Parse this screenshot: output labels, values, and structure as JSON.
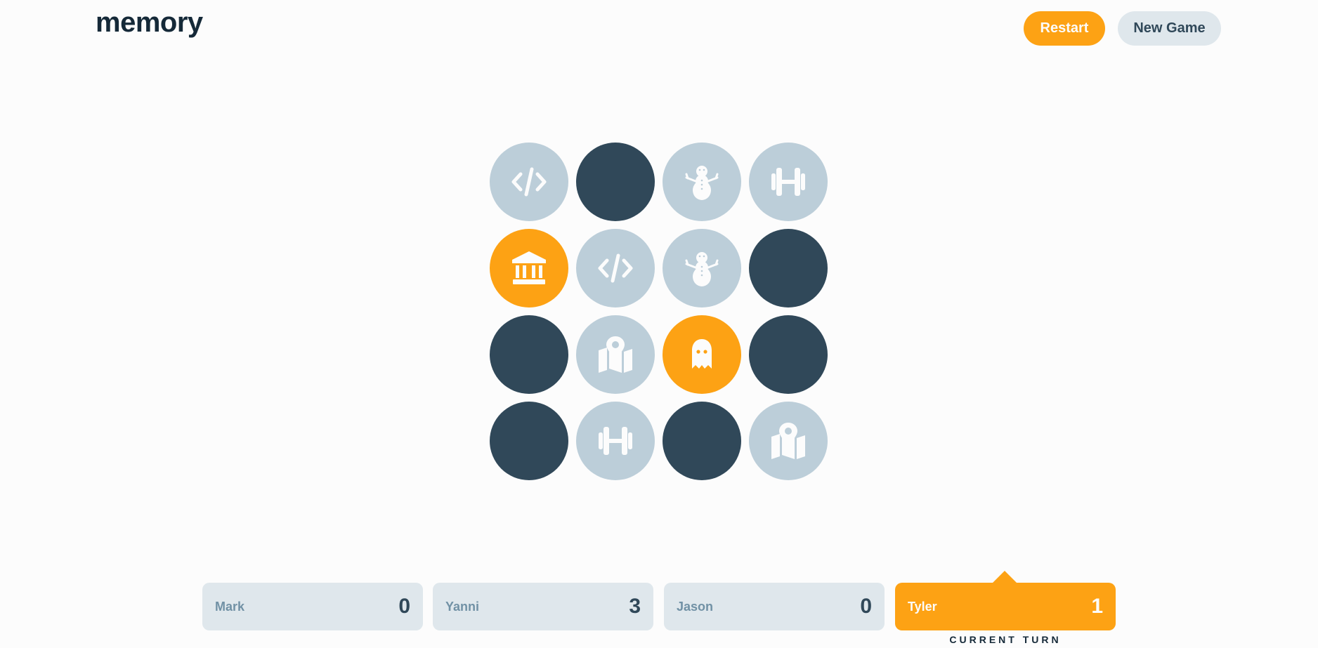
{
  "header": {
    "logo": "memory",
    "restart_label": "Restart",
    "new_game_label": "New Game"
  },
  "colors": {
    "hidden": "#304859",
    "matched": "#BCCED9",
    "active": "#FDA214",
    "text_dark": "#152938",
    "panel": "#DFE7EC"
  },
  "board": {
    "rows": 4,
    "cols": 4,
    "tiles": [
      {
        "state": "matched",
        "icon": "code-icon"
      },
      {
        "state": "hidden",
        "icon": ""
      },
      {
        "state": "matched",
        "icon": "snowman-icon"
      },
      {
        "state": "matched",
        "icon": "dumbbell-icon"
      },
      {
        "state": "active",
        "icon": "landmark-icon"
      },
      {
        "state": "matched",
        "icon": "code-icon"
      },
      {
        "state": "matched",
        "icon": "snowman-icon"
      },
      {
        "state": "hidden",
        "icon": ""
      },
      {
        "state": "hidden",
        "icon": ""
      },
      {
        "state": "matched",
        "icon": "map-location-icon"
      },
      {
        "state": "active",
        "icon": "ghost-icon"
      },
      {
        "state": "hidden",
        "icon": ""
      },
      {
        "state": "hidden",
        "icon": ""
      },
      {
        "state": "matched",
        "icon": "dumbbell-icon"
      },
      {
        "state": "hidden",
        "icon": ""
      },
      {
        "state": "matched",
        "icon": "map-location-icon"
      }
    ]
  },
  "players": [
    {
      "name": "Mark",
      "score": "0"
    },
    {
      "name": "Yanni",
      "score": "3"
    },
    {
      "name": "Jason",
      "score": "0"
    },
    {
      "name": "Tyler",
      "score": "1"
    }
  ],
  "current_player_index": 3,
  "current_turn_label": "CURRENT TURN"
}
